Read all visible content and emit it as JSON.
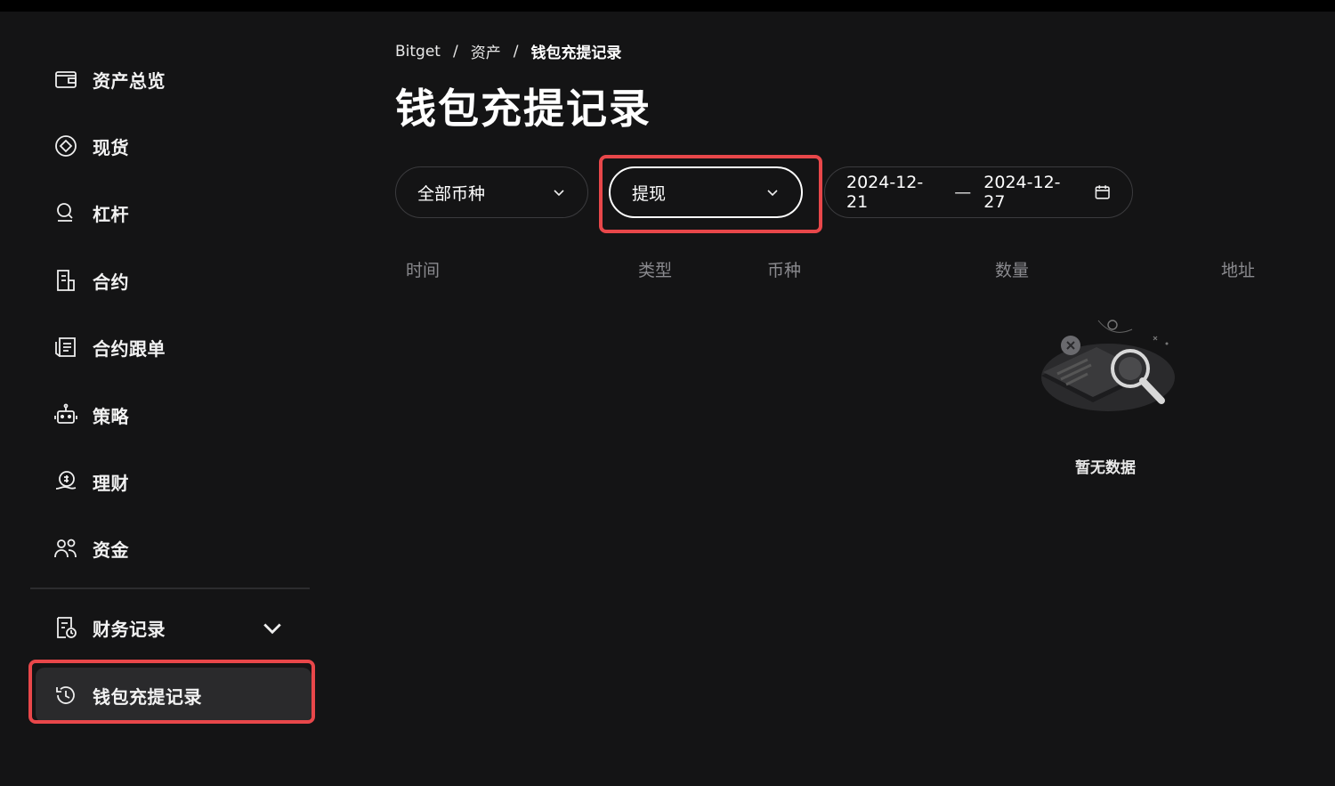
{
  "sidebar": {
    "items": [
      {
        "label": "资产总览",
        "icon": "wallet-icon"
      },
      {
        "label": "现货",
        "icon": "spot-icon"
      },
      {
        "label": "杠杆",
        "icon": "margin-icon"
      },
      {
        "label": "合约",
        "icon": "futures-icon"
      },
      {
        "label": "合约跟单",
        "icon": "copy-trade-icon"
      },
      {
        "label": "策略",
        "icon": "robot-icon"
      },
      {
        "label": "理财",
        "icon": "earn-icon"
      },
      {
        "label": "资金",
        "icon": "users-icon"
      }
    ],
    "finance": {
      "label": "财务记录",
      "icon": "finance-record-icon"
    },
    "active": {
      "label": "钱包充提记录",
      "icon": "history-icon"
    }
  },
  "breadcrumb": {
    "items": [
      "Bitget",
      "资产",
      "钱包充提记录"
    ],
    "separator": "/"
  },
  "page": {
    "title": "钱包充提记录"
  },
  "filters": {
    "coin": "全部币种",
    "type": "提现",
    "date_start": "2024-12-21",
    "date_sep": "—",
    "date_end": "2024-12-27"
  },
  "table": {
    "columns": [
      "时间",
      "类型",
      "币种",
      "数量",
      "地址"
    ]
  },
  "empty": {
    "text": "暂无数据"
  },
  "colors": {
    "background": "#141415",
    "highlight": "#e8474a",
    "muted": "#8a8a8e"
  }
}
